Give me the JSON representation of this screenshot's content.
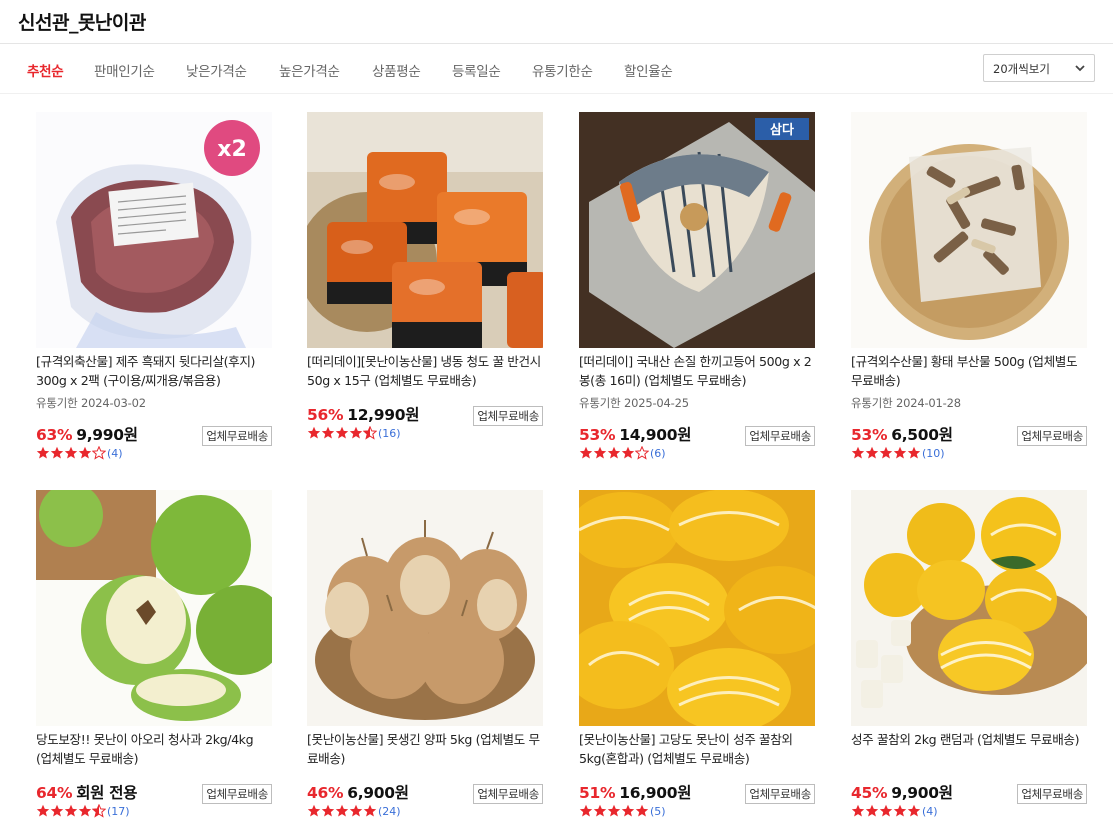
{
  "page": {
    "title": "신선관_못난이관"
  },
  "sort": {
    "tabs": [
      "추천순",
      "판매인기순",
      "낮은가격순",
      "높은가격순",
      "상품평순",
      "등록일순",
      "유통기한순",
      "할인율순"
    ],
    "active_index": 0
  },
  "perpage": {
    "label": "20개씩보기"
  },
  "colors": {
    "accent": "#e8272d",
    "star": "#e8272d",
    "count": "#3a6fd8"
  },
  "products": [
    {
      "title": "[규격외축산물] 제주 흑돼지 뒷다리살(후지) 300g x 2팩 (구이용/찌개용/볶음용)",
      "expiry": "유통기한 2024-03-02",
      "discount": "63%",
      "price": "9,990원",
      "badge": "업체무료배송",
      "rating": 4,
      "count": "(4)",
      "image": "pork-ham-vacuum-pack",
      "overlay": "x2"
    },
    {
      "title": "[떠리데이][못난이농산물] 냉동 청도 꿀 반건시 50g x 15구 (업체별도 무료배송)",
      "expiry": "",
      "discount": "56%",
      "price": "12,990원",
      "badge": "업체무료배송",
      "rating": 4.5,
      "count": "(16)",
      "image": "dried-persimmon-trays"
    },
    {
      "title": "[떠리데이] 국내산 손질 한끼고등어 500g x 2봉(총 16미) (업체별도 무료배송)",
      "expiry": "유통기한 2025-04-25",
      "discount": "53%",
      "price": "14,900원",
      "badge": "업체무료배송",
      "rating": 4,
      "count": "(6)",
      "image": "grilled-mackerel-plate",
      "overlay": "삼다"
    },
    {
      "title": "[규격외수산물] 황태 부산물 500g (업체별도 무료배송)",
      "expiry": "유통기한 2024-01-28",
      "discount": "53%",
      "price": "6,500원",
      "badge": "업체무료배송",
      "rating": 5,
      "count": "(10)",
      "image": "dried-pollock-bag"
    },
    {
      "title": "당도보장!! 못난이 아오리 청사과 2kg/4kg (업체별도 무료배송)",
      "expiry": "",
      "discount": "64%",
      "price": "회원 전용",
      "badge": "업체무료배송",
      "rating": 4.5,
      "count": "(17)",
      "image": "green-apples"
    },
    {
      "title": "[못난이농산물] 못생긴 양파 5kg (업체별도 무료배송)",
      "expiry": "",
      "discount": "46%",
      "price": "6,900원",
      "badge": "업체무료배송",
      "rating": 5,
      "count": "(24)",
      "image": "onions-basket"
    },
    {
      "title": "[못난이농산물] 고당도 못난이 성주 꿀참외 5kg(혼합과) (업체별도 무료배송)",
      "expiry": "",
      "discount": "51%",
      "price": "16,900원",
      "badge": "업체무료배송",
      "rating": 5,
      "count": "(5)",
      "image": "korean-melons-pile"
    },
    {
      "title": "성주 꿀참외 2kg 랜덤과 (업체별도 무료배송)",
      "expiry": "",
      "discount": "45%",
      "price": "9,900원",
      "badge": "업체무료배송",
      "rating": 5,
      "count": "(4)",
      "image": "korean-melons-basket"
    }
  ]
}
